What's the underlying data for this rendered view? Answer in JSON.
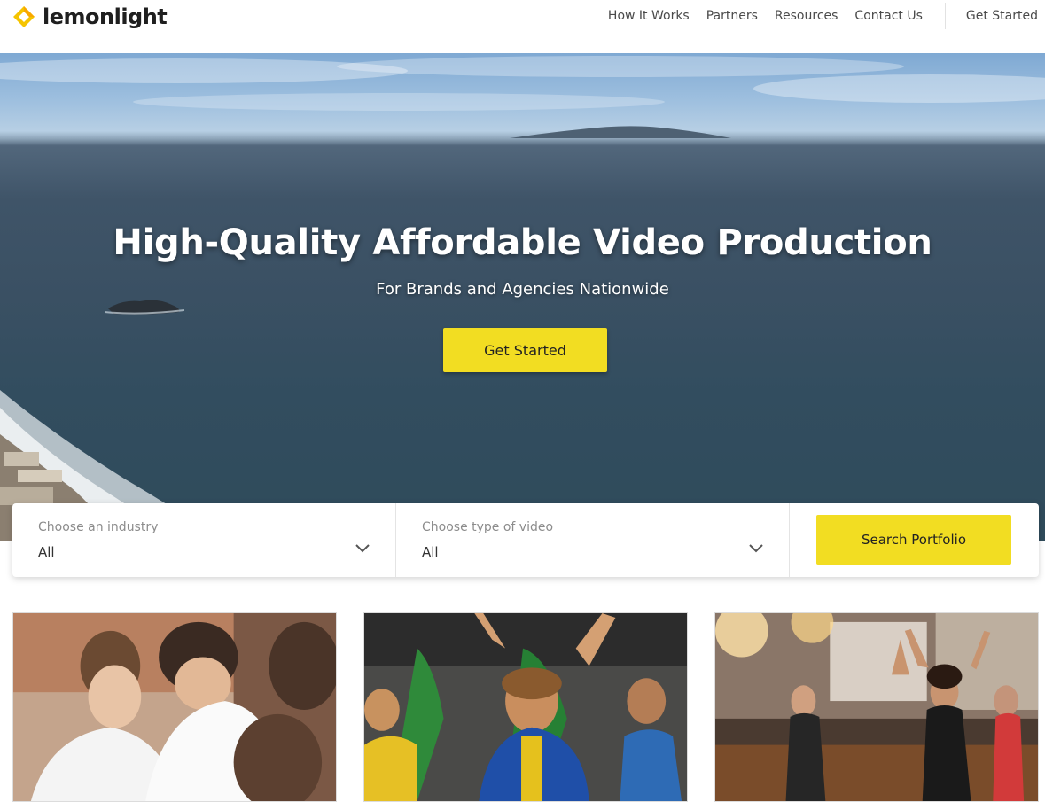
{
  "header": {
    "logo_text": "lemonlight",
    "logo_icon": "lemon-diamond-icon",
    "nav": {
      "how_it_works": "How It Works",
      "partners": "Partners",
      "resources": "Resources",
      "contact_us": "Contact Us",
      "get_started": "Get Started"
    }
  },
  "hero": {
    "title": "High-Quality Affordable Video Production",
    "subtitle": "For Brands and Agencies Nationwide",
    "cta_label": "Get Started",
    "cta_color": "#f2dd22"
  },
  "search": {
    "industry_label": "Choose an industry",
    "industry_value": "All",
    "type_label": "Choose type of video",
    "type_value": "All",
    "button_label": "Search Portfolio",
    "chevron_icon": "chevron-down-icon"
  },
  "portfolio": {
    "cards": [
      {
        "subject": "students in white polo shirts"
      },
      {
        "subject": "cheering crowd with Brazil flag"
      },
      {
        "subject": "dance class in studio"
      }
    ]
  },
  "colors": {
    "accent": "#f2dd22",
    "logo_yellow": "#f5c400",
    "text_dark": "#222222"
  }
}
